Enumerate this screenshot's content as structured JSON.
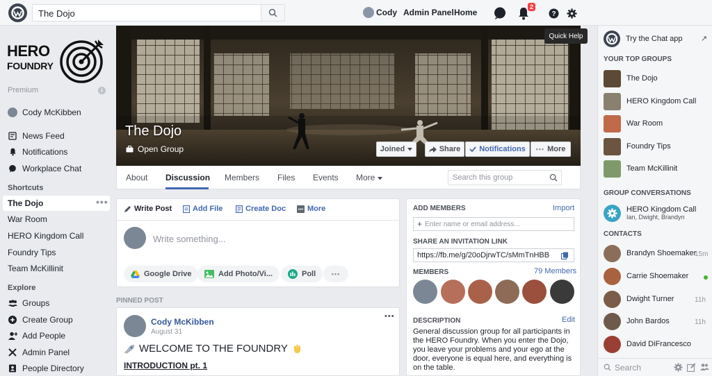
{
  "topbar": {
    "search_value": "The Dojo",
    "user_name": "Cody",
    "admin_panel": "Admin Panel",
    "home": "Home",
    "notification_count": "2",
    "tooltip": "Quick Help"
  },
  "brand": {
    "line1": "HERO",
    "line2": "FOUNDRY"
  },
  "leftnav": {
    "premium": "Premium",
    "profile_name": "Cody McKibben",
    "main": [
      "News Feed",
      "Notifications",
      "Workplace Chat"
    ],
    "shortcuts_title": "Shortcuts",
    "shortcuts": [
      "The Dojo",
      "War Room",
      "HERO Kingdom Call",
      "Foundry Tips",
      "Team McKillinit"
    ],
    "explore_title": "Explore",
    "explore": [
      "Groups",
      "Create Group",
      "Add People",
      "Admin Panel",
      "People Directory"
    ]
  },
  "cover": {
    "title": "The Dojo",
    "privacy": "Open Group",
    "joined": "Joined",
    "share": "Share",
    "notifications": "Notifications",
    "more": "More"
  },
  "tabs": {
    "items": [
      "About",
      "Discussion",
      "Members",
      "Files",
      "Events",
      "More"
    ],
    "search_placeholder": "Search this group"
  },
  "composer": {
    "write_post": "Write Post",
    "add_file": "Add File",
    "create_doc": "Create Doc",
    "more": "More",
    "placeholder": "Write something...",
    "google_drive": "Google Drive",
    "add_photo": "Add Photo/Vi...",
    "poll": "Poll"
  },
  "pinned": {
    "label": "PINNED POST",
    "author": "Cody McKibben",
    "date": "August 31",
    "title": "WELCOME TO THE FOUNDRY",
    "subtitle": "INTRODUCTION pt. 1"
  },
  "group_info": {
    "add_members": "ADD MEMBERS",
    "import": "Import",
    "add_placeholder": "Enter name or email address...",
    "share_link_title": "SHARE AN INVITATION LINK",
    "invite_link": "https://fb.me/g/20oDjrwTC/sMmTnHBB",
    "members_title": "MEMBERS",
    "member_count": "79 Members",
    "description_title": "DESCRIPTION",
    "edit": "Edit",
    "description": "General discussion group for all participants in the HERO Foundry. When you enter the Dojo, you leave your problems and your ego at the door, everyone is equal here, and everything is on the table."
  },
  "rightcol": {
    "chat_app": "Try the Chat app",
    "top_groups_title": "YOUR TOP GROUPS",
    "top_groups": [
      "The Dojo",
      "HERO Kingdom Call",
      "War Room",
      "Foundry Tips",
      "Team McKillinit"
    ],
    "conversations_title": "GROUP CONVERSATIONS",
    "conversation_name": "HERO Kingdom Call",
    "conversation_members": "Ian, Dwight, Brandyn",
    "contacts_title": "CONTACTS",
    "contacts": [
      {
        "name": "Brandyn Shoemaker",
        "time": "15m"
      },
      {
        "name": "Carrie Shoemaker",
        "time": ""
      },
      {
        "name": "Dwight Turner",
        "time": "11h"
      },
      {
        "name": "John Bardos",
        "time": "11h"
      },
      {
        "name": "David DiFrancesco",
        "time": ""
      }
    ],
    "search_placeholder": "Search"
  },
  "colors": {
    "accent": "#4267b2",
    "online": "#42b72a",
    "badge": "#fa3e3e"
  }
}
